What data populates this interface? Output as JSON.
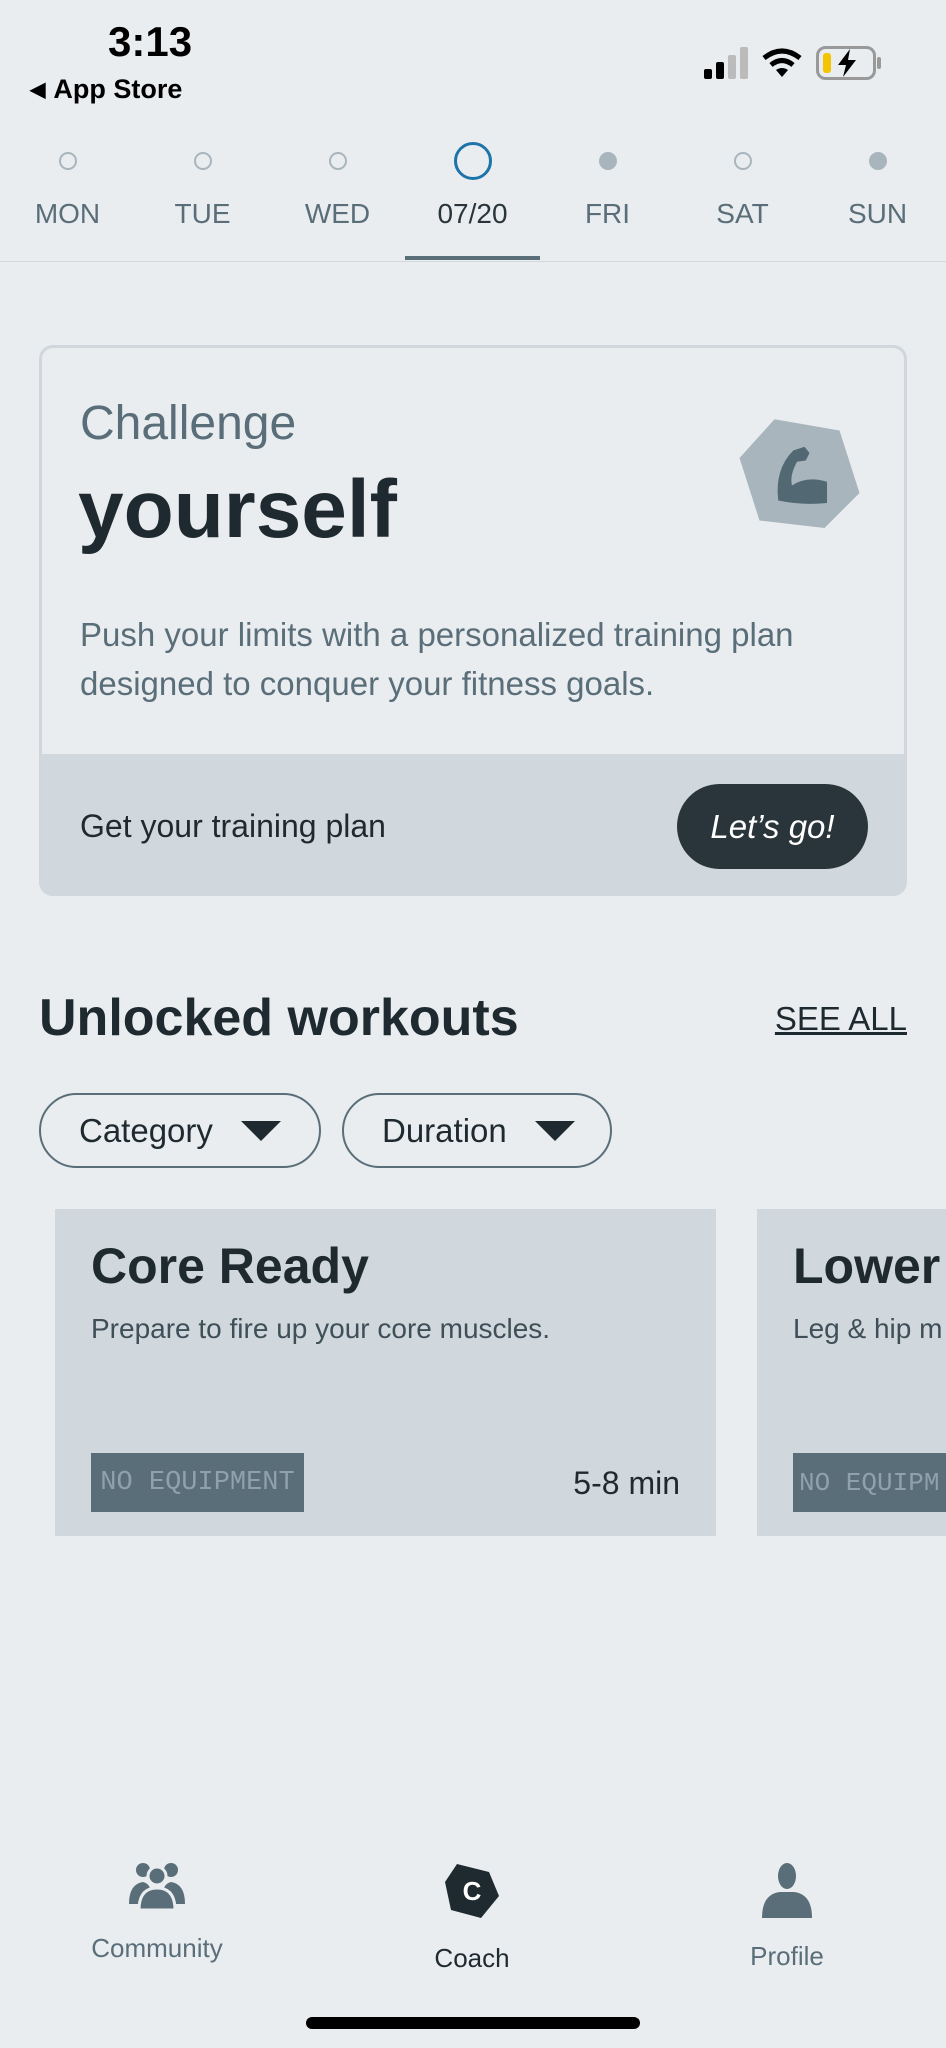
{
  "status_bar": {
    "time": "3:13",
    "back_label": "App Store",
    "battery_color": "#f5c400"
  },
  "week": {
    "days": [
      {
        "label": "MON",
        "state": "empty"
      },
      {
        "label": "TUE",
        "state": "empty"
      },
      {
        "label": "WED",
        "state": "empty"
      },
      {
        "label": "07/20",
        "state": "active"
      },
      {
        "label": "FRI",
        "state": "filled"
      },
      {
        "label": "SAT",
        "state": "empty"
      },
      {
        "label": "SUN",
        "state": "filled"
      }
    ],
    "active_color": "#1c74a8"
  },
  "challenge": {
    "kicker": "Challenge",
    "title": "yourself",
    "body": "Push your limits with a personalized training plan designed to conquer your fitness goals.",
    "icon": "flexed-bicep-icon",
    "cta_text": "Get your training plan",
    "button_label": "Let’s go!"
  },
  "workouts": {
    "title": "Unlocked workouts",
    "see_all": "SEE ALL",
    "filters": [
      "Category",
      "Duration"
    ],
    "cards": [
      {
        "title": "Core Ready",
        "description": "Prepare to fire up your core muscles.",
        "tag": "NO EQUIPMENT",
        "duration": "5-8 min"
      },
      {
        "title": "Lower",
        "description": "Leg & hip m",
        "tag": "NO EQUIPM",
        "duration": ""
      }
    ]
  },
  "tabs": [
    {
      "label": "Community",
      "icon": "community-icon"
    },
    {
      "label": "Coach",
      "icon": "coach-icon",
      "active": true
    },
    {
      "label": "Profile",
      "icon": "profile-icon"
    }
  ]
}
